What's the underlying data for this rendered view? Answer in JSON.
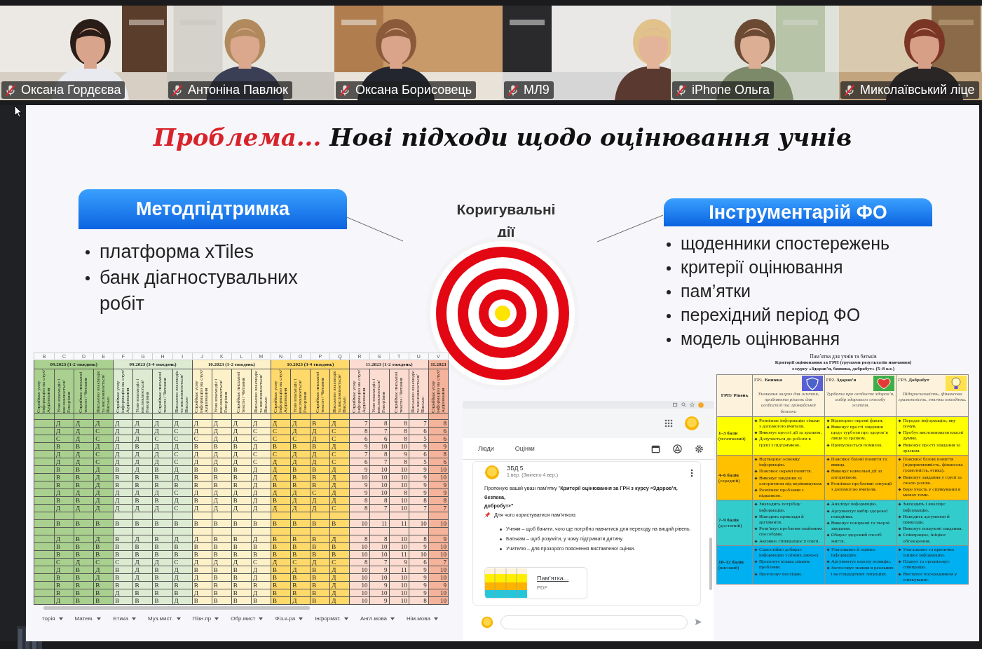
{
  "participants": [
    {
      "name": "Оксана Гордєєва",
      "muted": true
    },
    {
      "name": "Антоніна Павлюк",
      "muted": true
    },
    {
      "name": "Оксана Борисовець",
      "muted": true
    },
    {
      "name": "МЛ9",
      "muted": true
    },
    {
      "name": "iPhone Ольга",
      "muted": true
    },
    {
      "name": "Миколаївський ліце",
      "muted": true
    }
  ],
  "slide": {
    "title_accent": "Проблема...",
    "title": "Нові підходи щодо оцінювання учнів",
    "left_panel": {
      "heading": "Методпідтримка",
      "items": [
        "платформа xTiles",
        "банк діагностувальних робіт"
      ]
    },
    "center_label": "Коригувальні дії",
    "right_panel": {
      "heading": "Інструментарій ФО",
      "items": [
        "щоденники спостережень",
        "критерії оцінювання",
        "пам’ятки",
        "перехідний період ФО",
        "модель оцінювання"
      ]
    },
    "spreadsheet": {
      "groups": [
        {
          "label": "09.2023 (1-2 тиждень)",
          "columns": [
            {
              "letter": "B",
              "header": "Сприймає усну інформацію на слух/Аудіювання"
            },
            {
              "letter": "C",
              "header": "Усно взаємодіє і висловлюється/ Говоріння"
            },
            {
              "letter": "D",
              "header": "Сприймає письмові тексти / Читання"
            },
            {
              "letter": "E",
              "header": "Письмово взаємодіє та висловлюється/ Письмо"
            }
          ]
        },
        {
          "label": "09.2023 (3-4 тиждень)",
          "columns": [
            {
              "letter": "F",
              "header": "Сприймає усну інформацію на слух/Аудіювання"
            },
            {
              "letter": "G",
              "header": "Усно взаємодіє і висловлюється/ Говоріння"
            },
            {
              "letter": "H",
              "header": "Сприймає письмові тексти / Читання"
            },
            {
              "letter": "I",
              "header": "Письмово взаємодіє та висловлюється/ Письмо"
            }
          ]
        },
        {
          "label": "10.2023 (1-2 тиждень)",
          "columns": [
            {
              "letter": "J",
              "header": "Сприймає усну інформацію на слух/Аудіювання"
            },
            {
              "letter": "K",
              "header": "Усно взаємодіє і висловлюється/ Говоріння"
            },
            {
              "letter": "L",
              "header": "Сприймає письмові тексти / Читання"
            },
            {
              "letter": "M",
              "header": "Письмово взаємодіє та висловлюється/ Письмо"
            }
          ]
        },
        {
          "label": "10.2023 (3-4 тиждень)",
          "columns": [
            {
              "letter": "N",
              "header": "Сприймає усну інформацію на слух/Аудіювання"
            },
            {
              "letter": "O",
              "header": "Усно взаємодіє і висловлюється/ Говоріння"
            },
            {
              "letter": "P",
              "header": "Сприймає письмові тексти / Читання"
            },
            {
              "letter": "Q",
              "header": "Письмово взаємодіє та висловлюється/ Письмо"
            }
          ]
        },
        {
          "label": "11.2023 (1-2 тиждень)",
          "columns": [
            {
              "letter": "R",
              "header": "Сприймає усну інформацію на слух/Аудіювання"
            },
            {
              "letter": "S",
              "header": "Усно взаємодіє і висловлюється/ Говоріння"
            },
            {
              "letter": "T",
              "header": "Сприймає письмові тексти / Читання"
            },
            {
              "letter": "U",
              "header": "Письмово взаємодіє та висловлюється/ Письмо"
            }
          ]
        },
        {
          "label": "11.2023",
          "columns": [
            {
              "letter": "V",
              "header": "Сприймає усну інформацію на слух/Аудіювання"
            }
          ]
        }
      ],
      "rows": [
        {
          "kind": "grades",
          "cells": [
            "Д",
            "Д",
            "Д",
            "Д",
            "Д",
            "Д",
            "Д",
            "Д",
            "Д",
            "Д",
            "Д",
            "Д",
            "Д",
            "В",
            "Д",
            "7",
            "8",
            "8",
            "7",
            "8"
          ]
        },
        {
          "kind": "grades",
          "cells": [
            "Д",
            "Д",
            "С",
            "Д",
            "Д",
            "Д",
            "С",
            "Д",
            "Д",
            "Д",
            "С",
            "С",
            "Д",
            "Д",
            "С",
            "8",
            "7",
            "8",
            "6",
            "6"
          ]
        },
        {
          "kind": "grades",
          "cells": [
            "С",
            "Д",
            "С",
            "Д",
            "Д",
            "С",
            "С",
            "С",
            "Д",
            "Д",
            "С",
            "С",
            "С",
            "Д",
            "С",
            "6",
            "6",
            "8",
            "5",
            "6"
          ]
        },
        {
          "kind": "grades",
          "cells": [
            "В",
            "В",
            "Д",
            "Д",
            "В",
            "Д",
            "Д",
            "В",
            "В",
            "В",
            "Д",
            "В",
            "В",
            "В",
            "Д",
            "9",
            "10",
            "10",
            "9",
            "9"
          ]
        },
        {
          "kind": "grades",
          "cells": [
            "Д",
            "Д",
            "С",
            "Д",
            "Д",
            "Д",
            "С",
            "Д",
            "Д",
            "Д",
            "С",
            "С",
            "Д",
            "Д",
            "С",
            "7",
            "8",
            "9",
            "6",
            "8"
          ]
        },
        {
          "kind": "grades",
          "cells": [
            "Д",
            "Д",
            "С",
            "Д",
            "Д",
            "Д",
            "С",
            "Д",
            "Д",
            "Д",
            "С",
            "Д",
            "Д",
            "Д",
            "С",
            "6",
            "7",
            "8",
            "5",
            "6"
          ]
        },
        {
          "kind": "grades",
          "cells": [
            "В",
            "В",
            "Д",
            "В",
            "Д",
            "В",
            "Д",
            "В",
            "В",
            "В",
            "Д",
            "Д",
            "В",
            "В",
            "Д",
            "9",
            "10",
            "10",
            "9",
            "10"
          ]
        },
        {
          "kind": "grades",
          "cells": [
            "В",
            "В",
            "Д",
            "В",
            "В",
            "В",
            "Д",
            "В",
            "В",
            "В",
            "Д",
            "Д",
            "В",
            "В",
            "Д",
            "10",
            "10",
            "10",
            "9",
            "10"
          ]
        },
        {
          "kind": "grades",
          "cells": [
            "В",
            "В",
            "Д",
            "В",
            "В",
            "В",
            "В",
            "В",
            "В",
            "В",
            "Д",
            "В",
            "В",
            "В",
            "Д",
            "9",
            "10",
            "10",
            "9",
            "9"
          ]
        },
        {
          "kind": "grades",
          "cells": [
            "Д",
            "Д",
            "Д",
            "Д",
            "Д",
            "Д",
            "С",
            "Д",
            "Д",
            "Д",
            "Д",
            "Д",
            "Д",
            "С",
            "Д",
            "9",
            "10",
            "8",
            "9",
            "9"
          ]
        },
        {
          "kind": "grades",
          "cells": [
            "В",
            "В",
            "Д",
            "Д",
            "В",
            "В",
            "Д",
            "В",
            "Д",
            "В",
            "Д",
            "В",
            "Д",
            "Д",
            "Д",
            "8",
            "8",
            "10",
            "8",
            "8"
          ]
        },
        {
          "kind": "grades",
          "cells": [
            "Д",
            "Д",
            "Д",
            "Д",
            "Д",
            "Д",
            "С",
            "Д",
            "Д",
            "Д",
            "Д",
            "Д",
            "Д",
            "Д",
            "С",
            "8",
            "7",
            "10",
            "7",
            "7"
          ]
        },
        {
          "kind": "spacer"
        },
        {
          "kind": "grades",
          "cells": [
            "В",
            "В",
            "В",
            "В",
            "В",
            "В",
            "В",
            "В",
            "В",
            "В",
            "В",
            "В",
            "В",
            "В",
            "В",
            "10",
            "11",
            "11",
            "10",
            "10"
          ]
        },
        {
          "kind": "spacer"
        },
        {
          "kind": "grades",
          "cells": [
            "Д",
            "В",
            "Д",
            "В",
            "Д",
            "В",
            "Д",
            "Д",
            "В",
            "В",
            "Д",
            "В",
            "В",
            "В",
            "Д",
            "8",
            "8",
            "10",
            "8",
            "9"
          ]
        },
        {
          "kind": "grades",
          "cells": [
            "В",
            "В",
            "В",
            "В",
            "В",
            "В",
            "В",
            "В",
            "В",
            "В",
            "В",
            "В",
            "В",
            "В",
            "В",
            "10",
            "10",
            "10",
            "9",
            "10"
          ]
        },
        {
          "kind": "grades",
          "cells": [
            "В",
            "В",
            "В",
            "В",
            "В",
            "В",
            "В",
            "В",
            "В",
            "В",
            "В",
            "В",
            "В",
            "В",
            "В",
            "10",
            "10",
            "11",
            "10",
            "10"
          ]
        },
        {
          "kind": "grades",
          "cells": [
            "С",
            "Д",
            "С",
            "С",
            "Д",
            "Д",
            "С",
            "Д",
            "Д",
            "Д",
            "С",
            "Д",
            "С",
            "Д",
            "С",
            "8",
            "7",
            "9",
            "6",
            "7"
          ]
        },
        {
          "kind": "grades",
          "cells": [
            "Д",
            "В",
            "Д",
            "В",
            "Д",
            "В",
            "Д",
            "В",
            "В",
            "В",
            "Д",
            "В",
            "Д",
            "В",
            "Д",
            "10",
            "9",
            "11",
            "9",
            "10"
          ]
        },
        {
          "kind": "grades",
          "cells": [
            "В",
            "В",
            "Д",
            "В",
            "Д",
            "В",
            "Д",
            "Д",
            "В",
            "В",
            "Д",
            "В",
            "В",
            "В",
            "Д",
            "10",
            "10",
            "10",
            "9",
            "10"
          ]
        },
        {
          "kind": "grades",
          "cells": [
            "В",
            "В",
            "В",
            "В",
            "В",
            "В",
            "В",
            "В",
            "В",
            "В",
            "В",
            "В",
            "В",
            "В",
            "Д",
            "10",
            "9",
            "10",
            "9",
            "9"
          ]
        },
        {
          "kind": "grades",
          "cells": [
            "В",
            "В",
            "В",
            "Д",
            "В",
            "В",
            "В",
            "Д",
            "В",
            "В",
            "Д",
            "В",
            "В",
            "В",
            "Д",
            "10",
            "10",
            "10",
            "9",
            "10"
          ]
        },
        {
          "kind": "grades",
          "cells": [
            "Д",
            "В",
            "В",
            "В",
            "В",
            "В",
            "Д",
            "В",
            "В",
            "В",
            "В",
            "В",
            "Д",
            "В",
            "Д",
            "10",
            "9",
            "10",
            "8",
            "10"
          ]
        }
      ],
      "sheet_tabs": [
        "торія",
        "Матем.",
        "Етика",
        "Муз.мист.",
        "Пізн.пр",
        "Обр.мист",
        "Фіз.к-ра",
        "Інформат.",
        "Англ.мова",
        "Нім.мова"
      ]
    },
    "classroom": {
      "tabs": [
        {
          "label": "Люди",
          "selected": false
        },
        {
          "label": "Оцінки",
          "selected": false
        }
      ],
      "post": {
        "author": "ЗБД 5",
        "date": "1 вер. (Змінено 4 вер.)",
        "intro_lines": [
          "Пропоную вашій увазі пам’ятку \"**Критерії оцінювання за ГРН з курсу «Здоров’я, безпека,**",
          "**добробут»\"**"
        ],
        "purpose": "Для чого користуватися пам’яткою:",
        "bullets": [
          "Учням – щоб бачити, чого ще потрібно навчитися для переходу на вищий рівень.",
          "Батькам – щоб розуміти, у чому підтримати дитину.",
          "Учителю – для прозорого пояснення виставленої оцінки."
        ],
        "attachment": {
          "title": "Пам’ятка...",
          "type": "PDF"
        }
      }
    },
    "criteria_table": {
      "caption": "Пам’ятка для учнів та батьків",
      "title_lines": [
        "Критерії оцінювання за ГРН (групами результатів навчання)",
        "з курсу «Здоров’я, безпека, добробут» (5–8 кл.)"
      ],
      "corner": "ГРН/ Рівень",
      "groups": [
        {
          "label": "ГР1. **Безпека**",
          "description": "Уникання загроз для життя, прийняття рішень для особистої та громадської безпеки"
        },
        {
          "label": "ГР2. **Здоров’я**",
          "description": "Турбота про особисте здоров’я, вибір здорового способу життя."
        },
        {
          "label": "ГР3. **Добробут**",
          "description": "Підприємливість, фінансова грамотність, етична поведінка."
        }
      ],
      "rows": [
        {
          "points": "1–3 бали",
          "band": "(початковий)",
          "color": "#ffff00",
          "cells": [
            [
              "Розпізнає інформацію тільки з допомогою вчителя.",
              "Виконує прості дії за зразком.",
              "Долучається до роботи в групі з підтримкою."
            ],
            [
              "Відтворює окремі факти.",
              "Виконує прості завдання щодо турботи про здоров’я лише за зразком.",
              "Припускається помилок."
            ],
            [
              "Передає інформацію, яку почув.",
              "Пробує висловлювати власні думки.",
              "Виконує прості завдання за зразком."
            ]
          ]
        },
        {
          "points": "4–6 балів",
          "band": "(середній)",
          "color": "#ffc000",
          "cells": [
            [
              "Відтворює основну інформацію.",
              "Пояснює окремі поняття.",
              "Виконує завдання за алгоритмом під керівництвом.",
              "Розпізнає проблеми з підказкою."
            ],
            [
              "Пояснює базові поняття та явища.",
              "Виконує навчальні дії за алгоритмом.",
              "Розпізнає проблемні ситуації з допомогою вчителя."
            ],
            [
              "Пояснює базові поняття (підприємливість, фінансова грамотність, етика).",
              "Виконує завдання у групі за своєю роллю.",
              "Бере участь у спілкуванні в межах теми."
            ]
          ]
        },
        {
          "points": "7–9 балів",
          "band": "(достатній)",
          "color": "#33cccc",
          "cells": [
            [
              "Знаходить потрібну інформацію.",
              "Наводить приклади й аргументи.",
              "Розв’язує проблеми знайомим способами.",
              "Активно співпрацює у групі."
            ],
            [
              "Аналізує інформацію.",
              "Аргументує вибір здорової поведінки.",
              "Виконує пошукові та творчі завдання.",
              "Обирає здоровий спосіб життя."
            ],
            [
              "Знаходить і аналізує інформацію.",
              "Наводить аргументи й приклади.",
              "Виконує пошукові завдання.",
              "Співпрацює, ініціює обговорення."
            ]
          ]
        },
        {
          "points": "10–12 балів",
          "band": "(високий)",
          "color": "#00b0f0",
          "cells": [
            [
              "Самостійно добирає інформацію з різних джерел.",
              "Пропонує кілька рішень проблеми.",
              "Прогнозує наслідки."
            ],
            [
              "Узагальнює й оцінює інформацію.",
              "Аргументує власну позицію.",
              "Застосовує знання в реальних і нестандартних ситуаціях."
            ],
            [
              "Узагальнює та критично оцінює інформацію.",
              "Планує та організовує співпрацю.",
              "Виступає посередником у спілкуванні."
            ]
          ]
        }
      ]
    }
  }
}
